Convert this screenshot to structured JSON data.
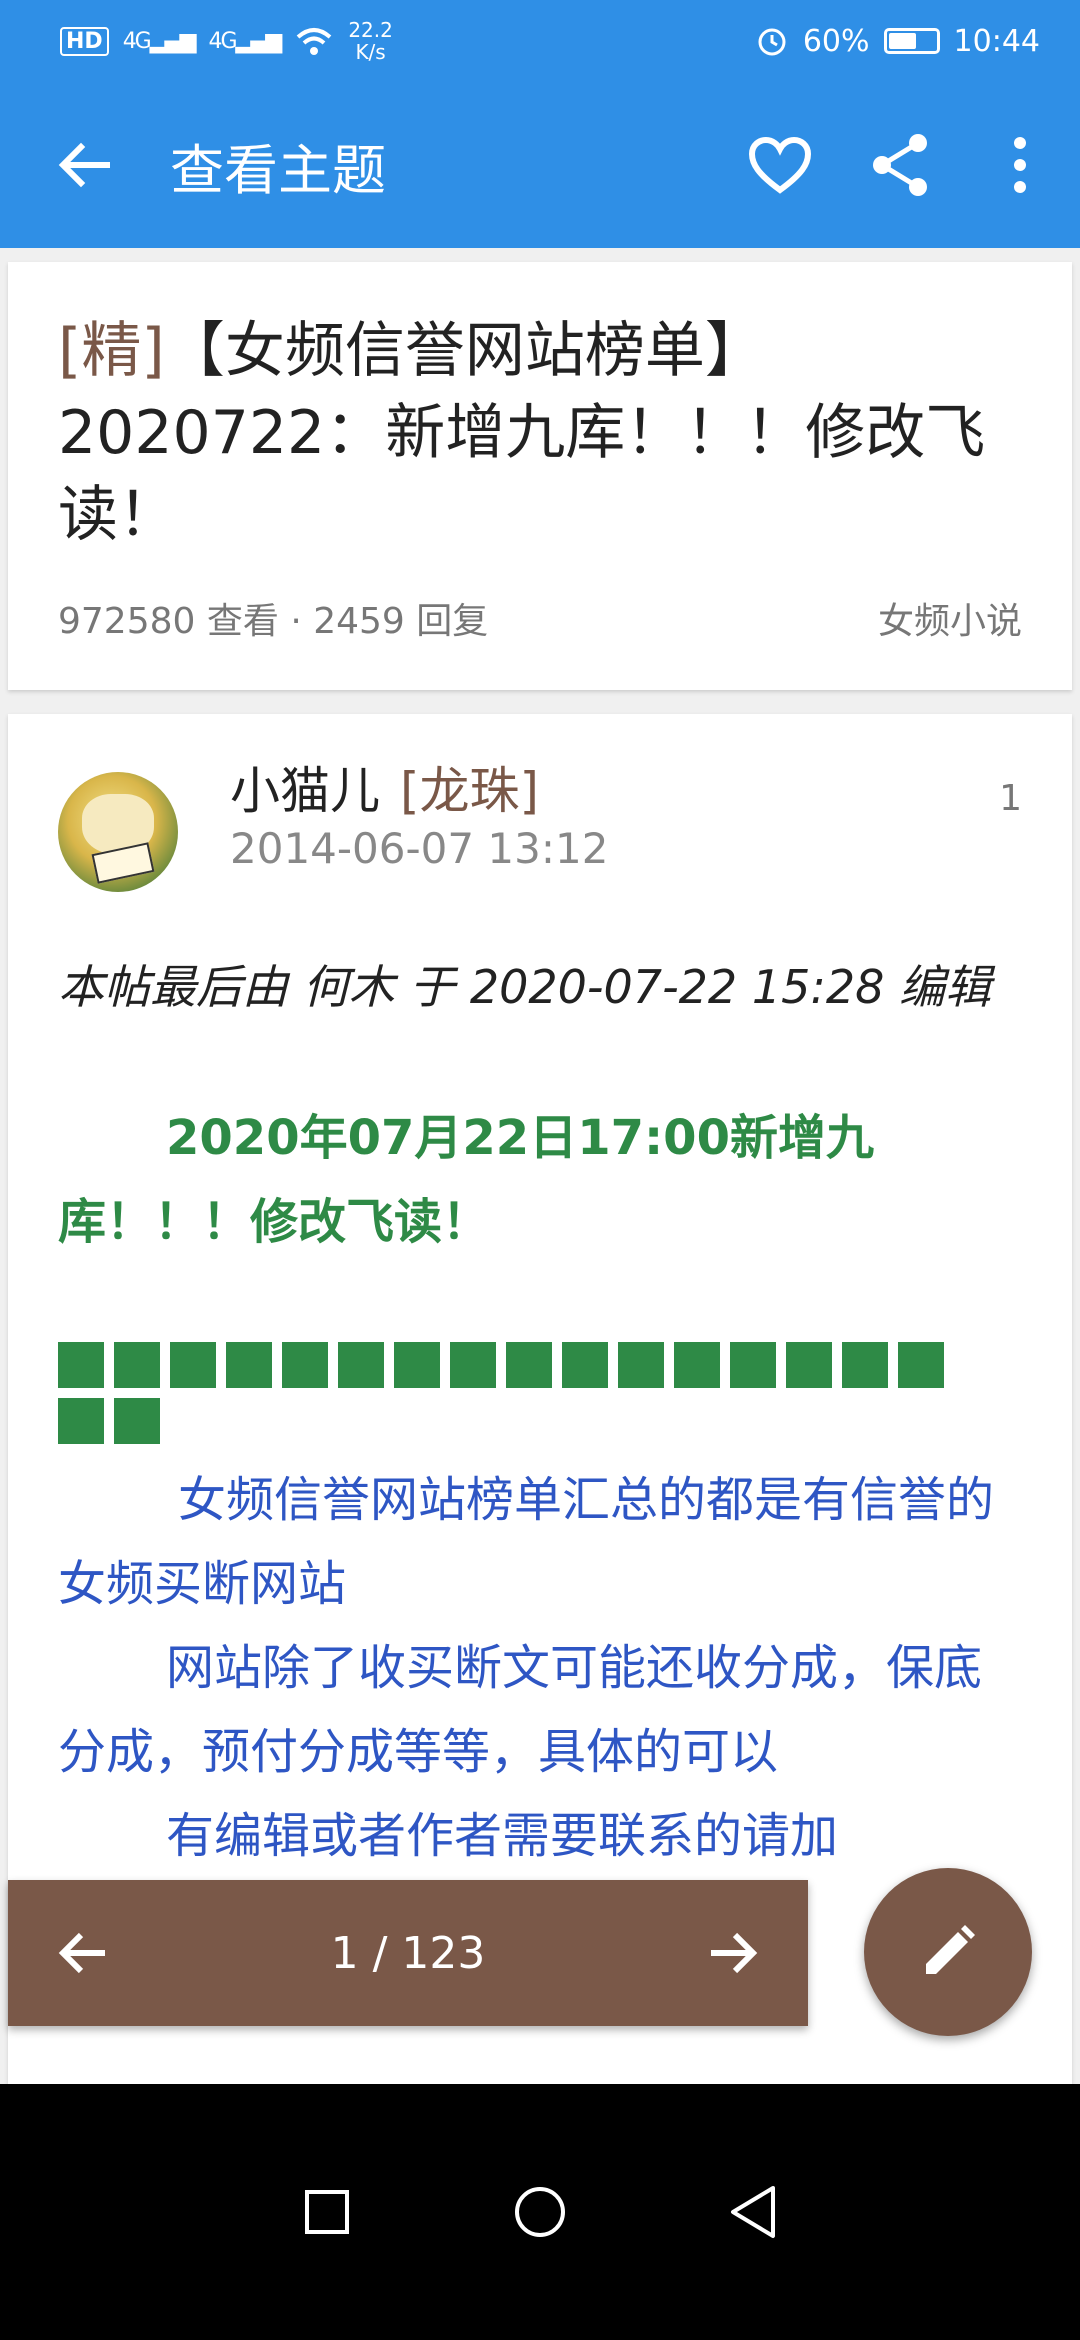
{
  "status_bar": {
    "hd": "HD",
    "sig1": "4G",
    "sig2": "4G",
    "speed_value": "22.2",
    "speed_unit": "K/s",
    "battery_pct": "60%",
    "battery_level": 0.6,
    "time": "10:44",
    "icons": [
      "alarm-icon",
      "wifi-icon",
      "battery-icon",
      "signal-icon"
    ]
  },
  "app_bar": {
    "title": "查看主题",
    "icons": [
      "back-arrow-icon",
      "heart-icon",
      "share-icon",
      "more-vert-icon"
    ]
  },
  "topic": {
    "tag": "[精]",
    "title": "【女频信誉网站榜单】2020722：新增九库！！！修改飞读！",
    "stats": "972580 查看 · 2459 回复",
    "forum": "女频小说"
  },
  "post": {
    "author": "小猫儿",
    "rank": "[龙珠]",
    "date": "2014-06-07 13:12",
    "floor": "1",
    "edit_note": "本帖最后由 何木 于 2020-07-22 15:28 编辑",
    "green_headline": "2020年07月22日17:00新增九库！！！修改飞读！",
    "square_count": 18,
    "paragraphs": [
      "女频信誉网站榜单汇总的都是有信誉的女频买断网站",
      "网站除了收买断文可能还收分成，保底分成，预付分成等等，具体的可以",
      "有编辑或者作者需要联系的请加"
    ]
  },
  "pager": {
    "label": "1 / 123",
    "icons": [
      "prev-arrow-icon",
      "next-arrow-icon"
    ]
  },
  "fab": {
    "icon": "pencil-icon"
  },
  "nav_bar": {
    "icons": [
      "recents-square-icon",
      "home-circle-icon",
      "back-triangle-icon"
    ]
  },
  "colors": {
    "primary": "#2f8fe6",
    "accent_brown": "#7a5848",
    "green_text": "#2e8a46",
    "blue_text": "#2e56c4"
  }
}
